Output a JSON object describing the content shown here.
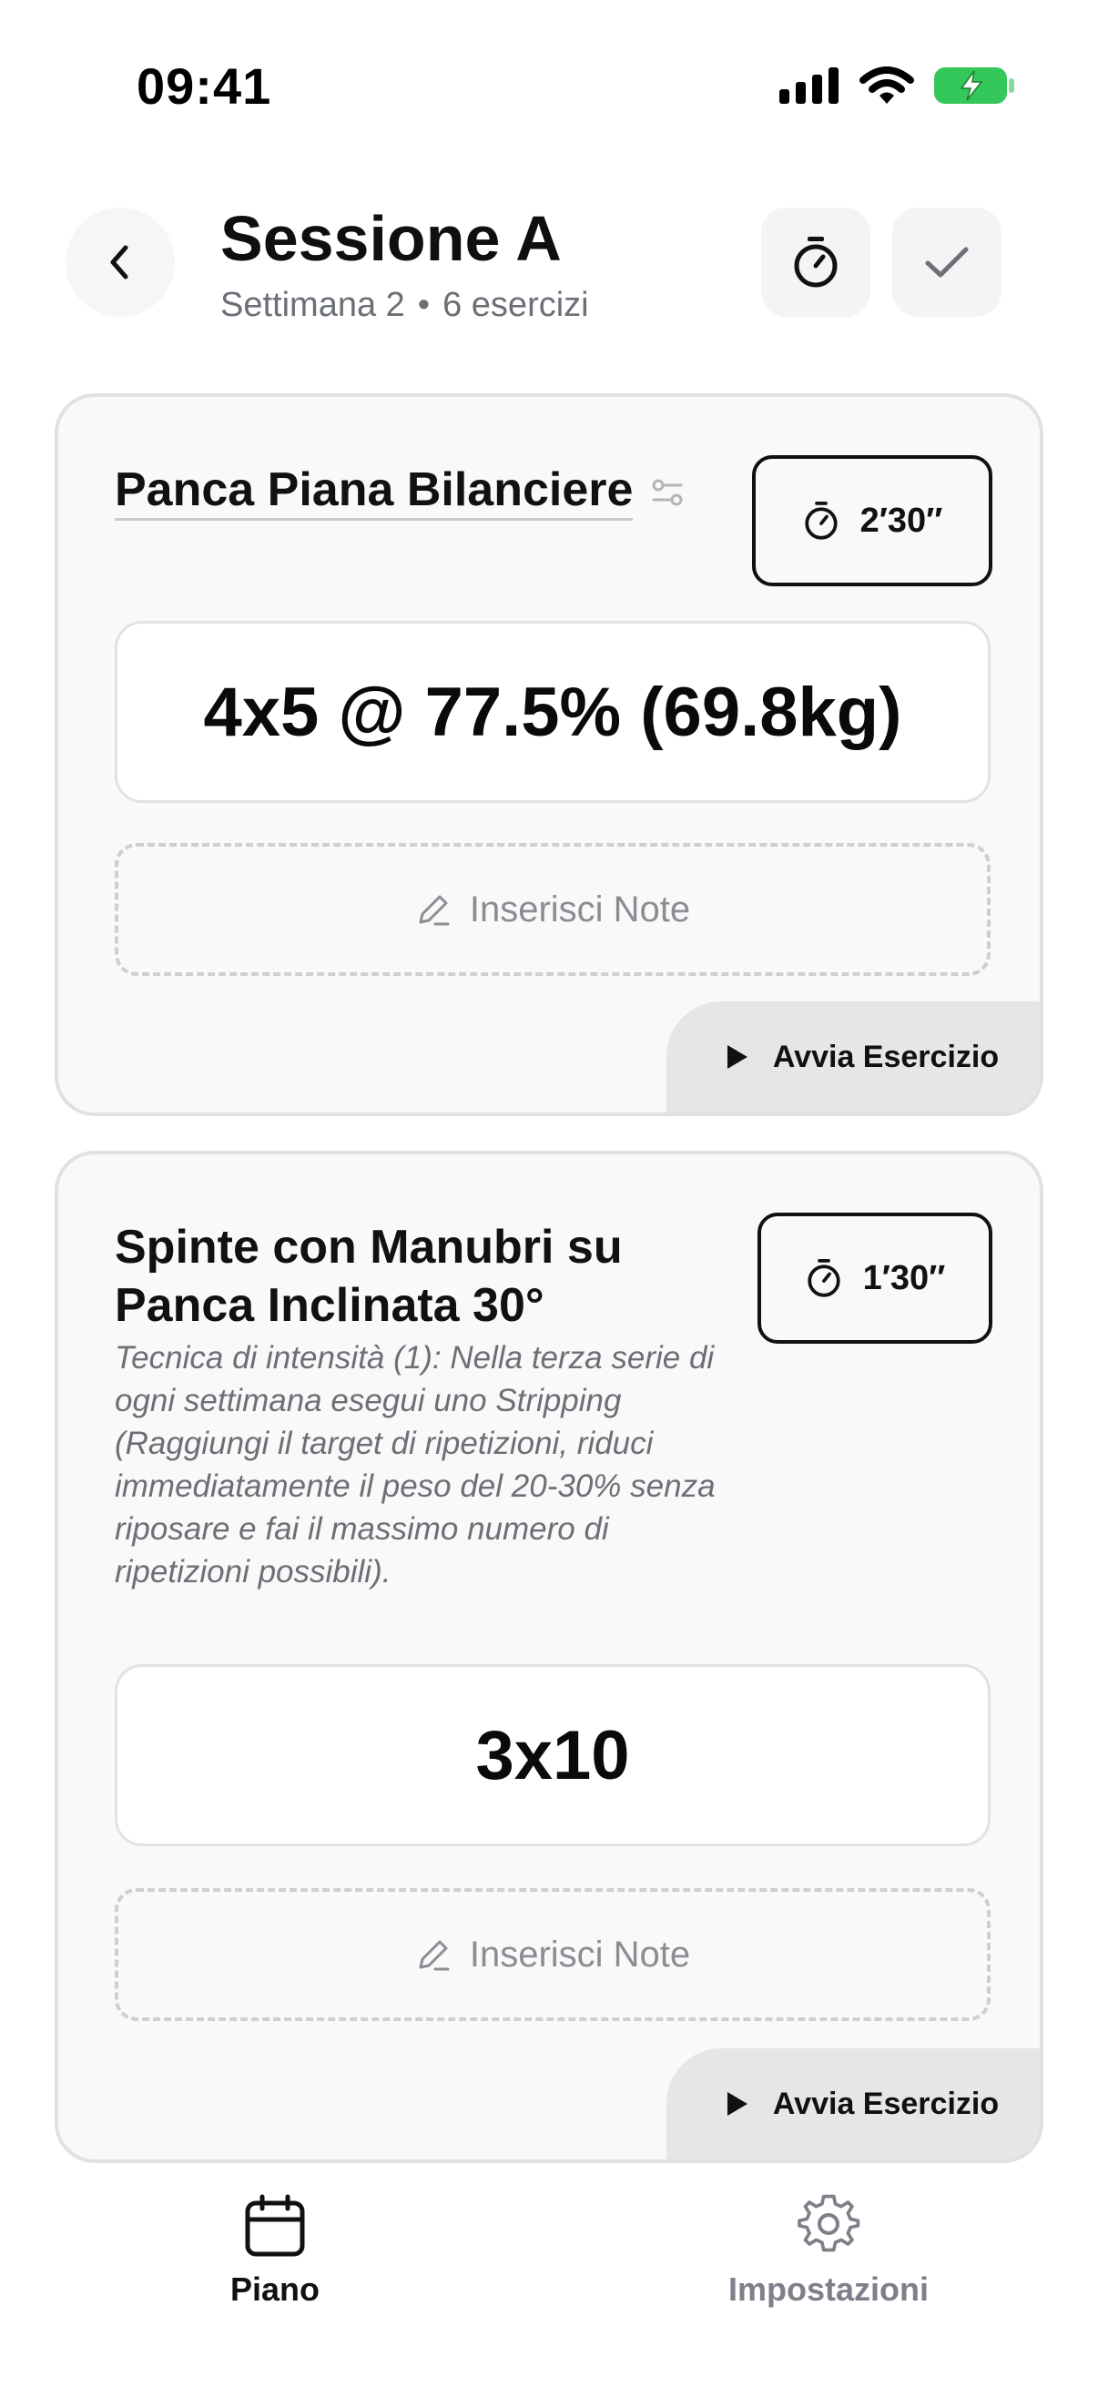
{
  "status_bar": {
    "time": "09:41"
  },
  "header": {
    "title": "Sessione A",
    "subtitle_week": "Settimana 2",
    "subtitle_sep": "•",
    "subtitle_count": "6 esercizi"
  },
  "exercises": [
    {
      "name": "Panca Piana Bilanciere",
      "rest": "2′30″",
      "scheme": "4x5 @ 77.5% (69.8kg)",
      "notes_placeholder": "Inserisci Note",
      "start_label": "Avvia Esercizio"
    },
    {
      "name_line1": "Spinte con Manubri su",
      "name_line2": "Panca Inclinata 30°",
      "description": "Tecnica di intensità (1): Nella terza serie di ogni settimana esegui uno Stripping (Raggiungi il target di ripetizioni, riduci immediatamente il peso del 20-30% senza riposare e fai il massimo numero di ripetizioni possibili).",
      "rest": "1′30″",
      "scheme": "3x10",
      "notes_placeholder": "Inserisci Note",
      "start_label": "Avvia Esercizio"
    }
  ],
  "tabbar": {
    "plan_label": "Piano",
    "settings_label": "Impostazioni"
  },
  "colors": {
    "battery": "#34c759",
    "inactive_tab": "#7d8088",
    "card_bg": "#f9f9f9"
  },
  "icons": [
    "signal-icon",
    "wifi-icon",
    "battery-icon",
    "back-chevron-icon",
    "stopwatch-icon",
    "checkmark-icon",
    "adjust-icon",
    "pencil-icon",
    "play-icon",
    "calendar-icon",
    "gear-icon"
  ]
}
